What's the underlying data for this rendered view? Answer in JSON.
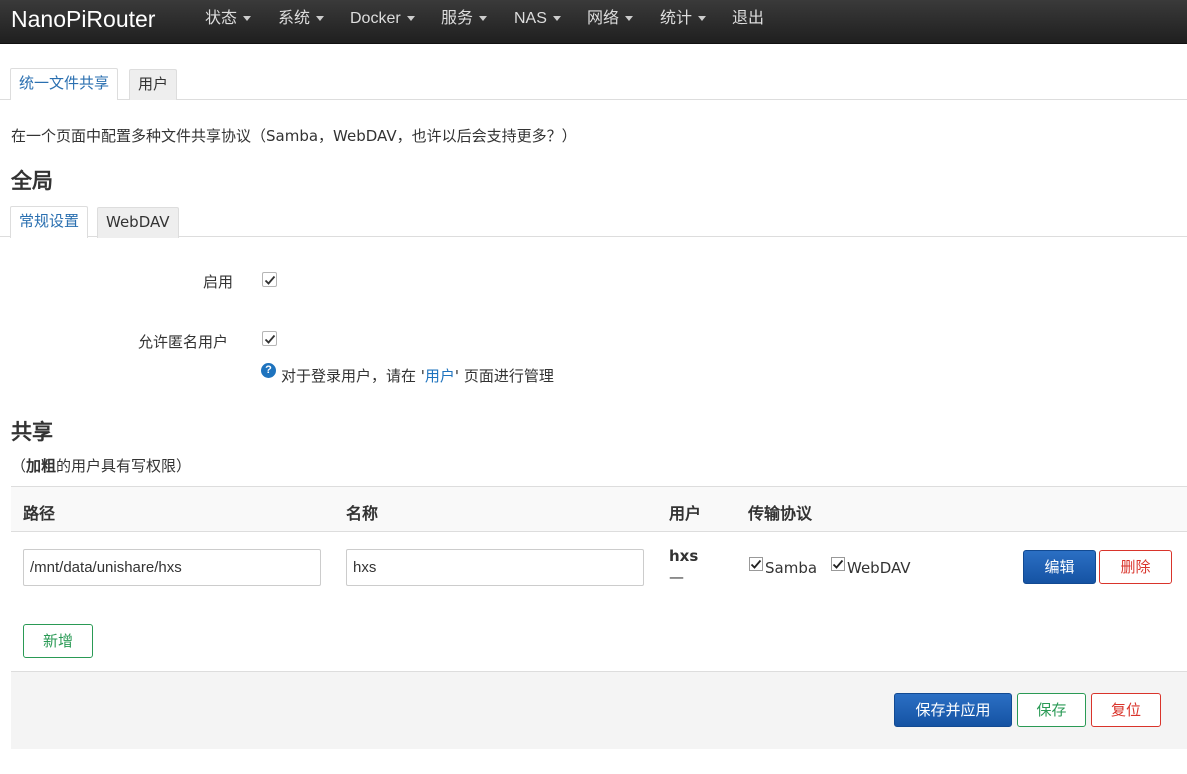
{
  "app": {
    "brand": "NanoPiRouter"
  },
  "nav": [
    {
      "label": "状态",
      "caret": true
    },
    {
      "label": "系统",
      "caret": true
    },
    {
      "label": "Docker",
      "caret": true
    },
    {
      "label": "服务",
      "caret": true
    },
    {
      "label": "NAS",
      "caret": true
    },
    {
      "label": "网络",
      "caret": true
    },
    {
      "label": "统计",
      "caret": true
    },
    {
      "label": "退出",
      "caret": false
    }
  ],
  "page_tabs": [
    {
      "label": "统一文件共享",
      "active": true
    },
    {
      "label": "用户",
      "active": false
    }
  ],
  "description": "在一个页面中配置多种文件共享协议（Samba，WebDAV，也许以后会支持更多？）",
  "global": {
    "title": "全局",
    "tabs": [
      {
        "label": "常规设置",
        "active": true
      },
      {
        "label": "WebDAV",
        "active": false
      }
    ],
    "enable_label": "启用",
    "enable_checked": true,
    "anon_label": "允许匿名用户",
    "anon_checked": true,
    "help_prefix": "对于登录用户，请在 '",
    "help_link": "用户",
    "help_suffix": "' 页面进行管理"
  },
  "shares": {
    "title": "共享",
    "note_open": "（",
    "note_bold": "加粗",
    "note_rest": "的用户具有写权限）",
    "columns": {
      "path": "路径",
      "name": "名称",
      "users": "用户",
      "protocols": "传输协议"
    },
    "rows": [
      {
        "path": "/mnt/data/unishare/hxs",
        "name": "hxs",
        "user_bold": "hxs",
        "user_other": "—",
        "samba_label": "Samba",
        "samba_checked": true,
        "webdav_label": "WebDAV",
        "webdav_checked": true,
        "edit_label": "编辑",
        "delete_label": "删除"
      }
    ],
    "add_label": "新增"
  },
  "footer": {
    "save_apply": "保存并应用",
    "save": "保存",
    "reset": "复位"
  },
  "colors": {
    "primary": "#1553a3",
    "danger": "#d9342b",
    "success": "#2a9a55",
    "link": "#1e73be",
    "navbar": "#2a2a2a"
  }
}
